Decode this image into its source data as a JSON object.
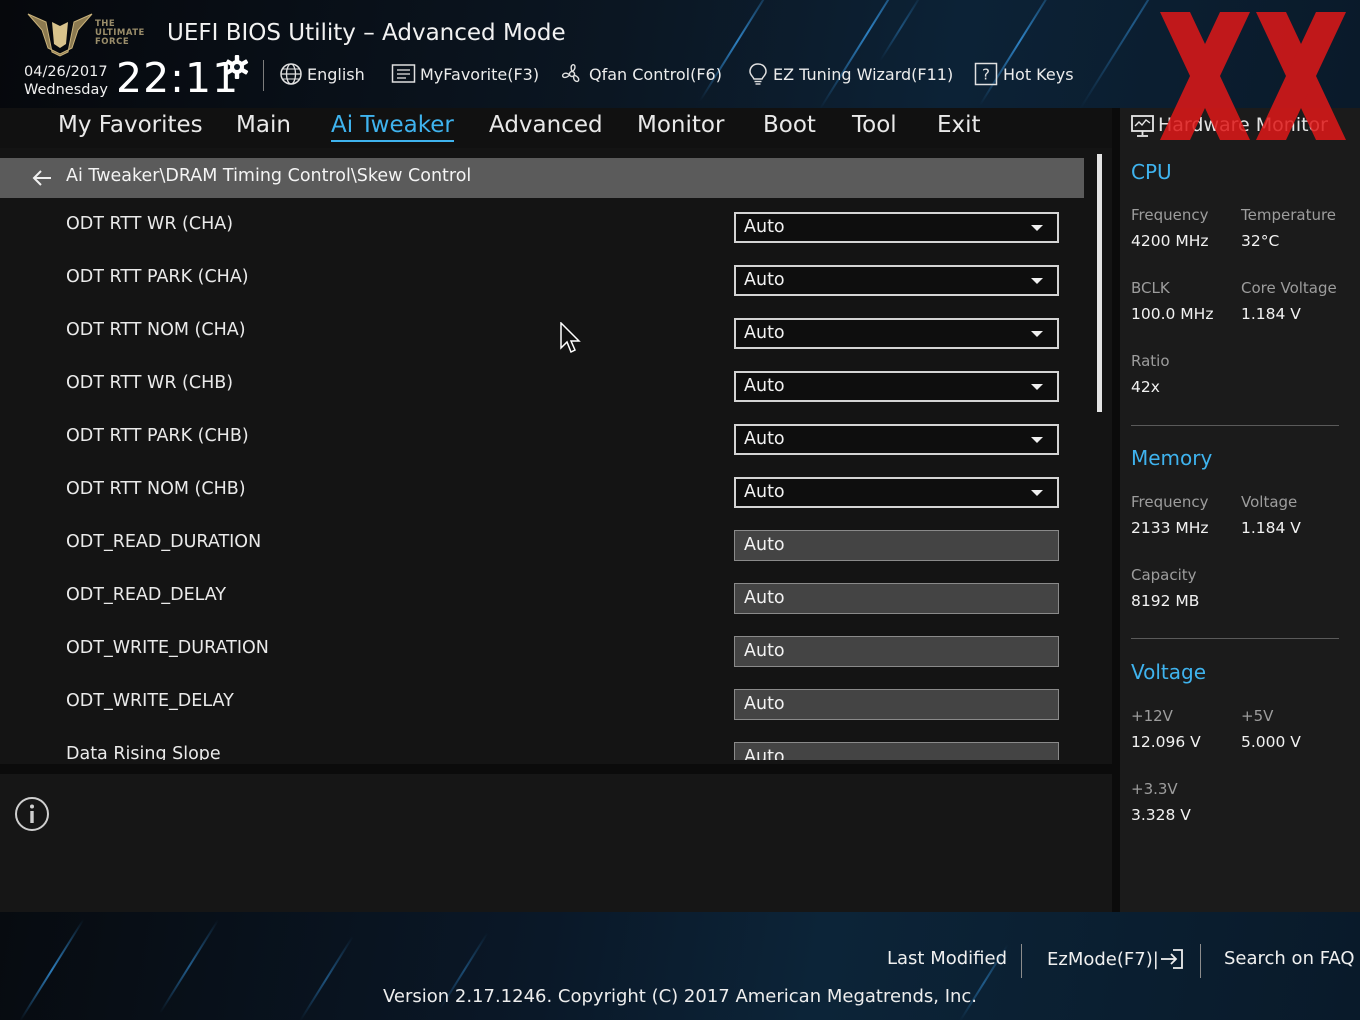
{
  "header": {
    "logo_text": [
      "THE",
      "ULTIMATE",
      "FORCE"
    ],
    "title": "UEFI BIOS Utility – Advanced Mode",
    "date": "04/26/2017",
    "weekday": "Wednesday",
    "time": "22:11",
    "tools": [
      {
        "label": "English",
        "icon": "globe-icon"
      },
      {
        "label": "MyFavorite(F3)",
        "icon": "favorite-list-icon"
      },
      {
        "label": "Qfan Control(F6)",
        "icon": "fan-icon"
      },
      {
        "label": "EZ Tuning Wizard(F11)",
        "icon": "lightbulb-icon"
      },
      {
        "label": "Hot Keys",
        "icon": "help-key-icon"
      }
    ]
  },
  "menu": {
    "active": "Ai Tweaker",
    "items": [
      "My Favorites",
      "Main",
      "Ai Tweaker",
      "Advanced",
      "Monitor",
      "Boot",
      "Tool",
      "Exit"
    ]
  },
  "breadcrumb": "Ai Tweaker\\DRAM Timing Control\\Skew Control",
  "settings": [
    {
      "label": "ODT RTT WR (CHA)",
      "value": "Auto",
      "type": "dropdown"
    },
    {
      "label": "ODT RTT PARK (CHA)",
      "value": "Auto",
      "type": "dropdown"
    },
    {
      "label": "ODT RTT NOM (CHA)",
      "value": "Auto",
      "type": "dropdown"
    },
    {
      "label": "ODT RTT WR (CHB)",
      "value": "Auto",
      "type": "dropdown"
    },
    {
      "label": "ODT RTT PARK (CHB)",
      "value": "Auto",
      "type": "dropdown"
    },
    {
      "label": "ODT RTT NOM (CHB)",
      "value": "Auto",
      "type": "dropdown"
    },
    {
      "label": "ODT_READ_DURATION",
      "value": "Auto",
      "type": "text"
    },
    {
      "label": "ODT_READ_DELAY",
      "value": "Auto",
      "type": "text"
    },
    {
      "label": "ODT_WRITE_DURATION",
      "value": "Auto",
      "type": "text"
    },
    {
      "label": "ODT_WRITE_DELAY",
      "value": "Auto",
      "type": "text"
    },
    {
      "label": "Data Rising Slope",
      "value": "Auto",
      "type": "text"
    }
  ],
  "hardware_monitor": {
    "title": "Hardware Monitor",
    "cpu": {
      "heading": "CPU",
      "frequency_label": "Frequency",
      "frequency": "4200 MHz",
      "temperature_label": "Temperature",
      "temperature": "32°C",
      "bclk_label": "BCLK",
      "bclk": "100.0 MHz",
      "core_voltage_label": "Core Voltage",
      "core_voltage": "1.184 V",
      "ratio_label": "Ratio",
      "ratio": "42x"
    },
    "memory": {
      "heading": "Memory",
      "frequency_label": "Frequency",
      "frequency": "2133 MHz",
      "voltage_label": "Voltage",
      "voltage": "1.184 V",
      "capacity_label": "Capacity",
      "capacity": "8192 MB"
    },
    "voltage": {
      "heading": "Voltage",
      "v12_label": "+12V",
      "v12": "12.096 V",
      "v5_label": "+5V",
      "v5": "5.000 V",
      "v33_label": "+3.3V",
      "v33": "3.328 V"
    }
  },
  "footer": {
    "last_modified": "Last Modified",
    "ez_mode": "EzMode(F7)|",
    "search_faq": "Search on FAQ",
    "version": "Version 2.17.1246. Copyright (C) 2017 American Megatrends, Inc."
  },
  "colors": {
    "accent": "#3fb3ee",
    "watermark": "#e01818"
  }
}
